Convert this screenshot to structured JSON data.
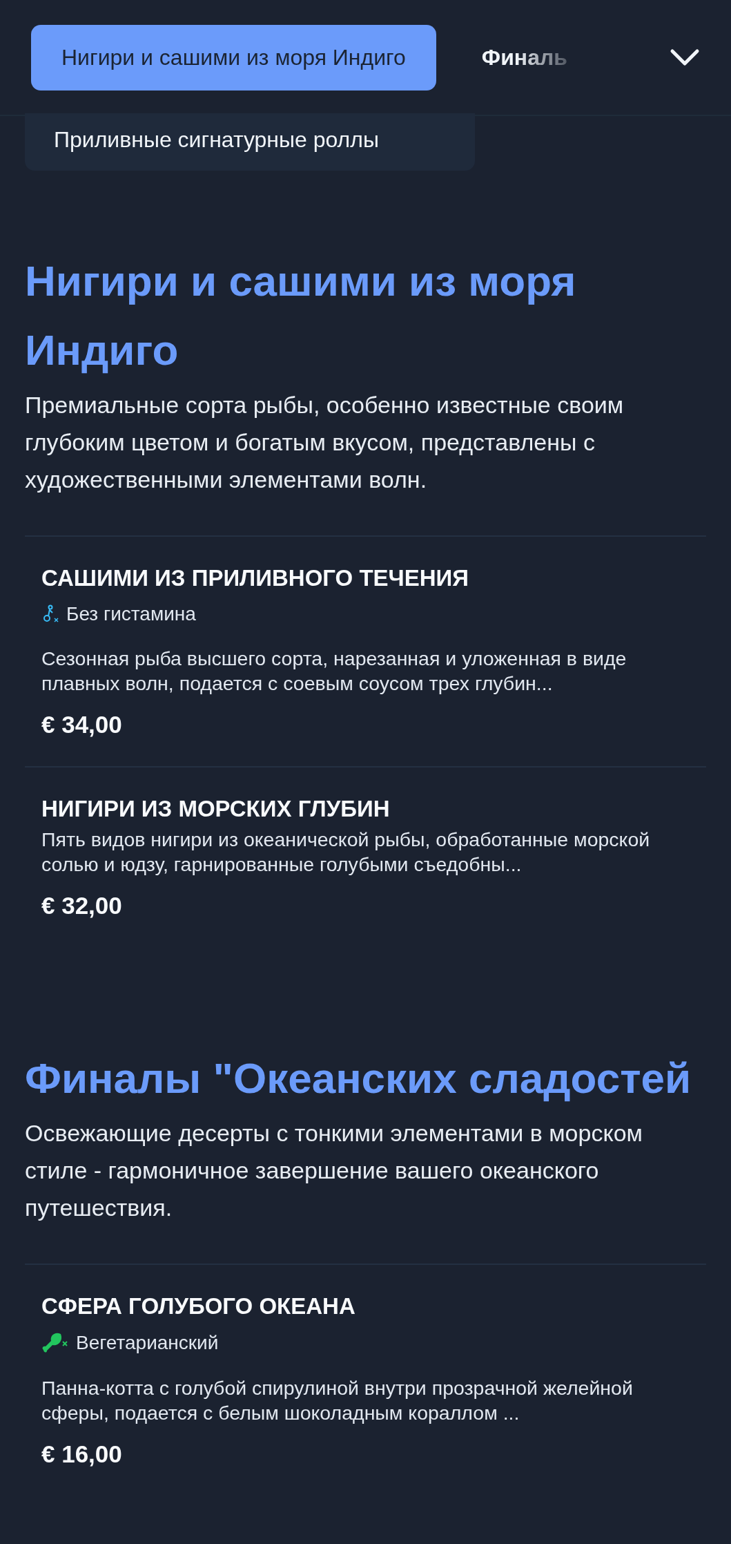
{
  "tabs": [
    {
      "label": "Нигири и сашими из моря Индиго",
      "selected": true
    },
    {
      "label": "Финаль",
      "selected": false
    }
  ],
  "menu": {
    "items": [
      "Приливные сигнатурные роллы"
    ]
  },
  "sections": [
    {
      "title": "Нигири и сашими из моря Индиго",
      "description": "Премиальные сорта рыбы, особенно известные своим глубоким цветом и богатым вкусом, представлены с художественными элементами волн.",
      "items": [
        {
          "name": "САШИМИ ИЗ ПРИЛИВНОГО ТЕЧЕНИЯ",
          "tag": {
            "kind": "histamine-free",
            "label": "Без гистамина",
            "color": "#38bdf8"
          },
          "description": "Сезонная рыба высшего сорта, нарезанная и уложенная в виде плавных волн, подается с соевым соусом трех глубин...",
          "price": "€ 34,00"
        },
        {
          "name": "НИГИРИ ИЗ МОРСКИХ ГЛУБИН",
          "description": "Пять видов нигири из океанической рыбы, обработанные морской солью и юдзу, гарнированные голубыми съедобны...",
          "price": "€ 32,00"
        }
      ]
    },
    {
      "title": "Финалы \"Океанских сладостей",
      "description": "Освежающие десерты с тонкими элементами в морском стиле - гармоничное завершение вашего океанского путешествия.",
      "items": [
        {
          "name": "СФЕРА ГОЛУБОГО ОКЕАНА",
          "tag": {
            "kind": "vegetarian",
            "label": "Вегетарианский",
            "color": "#22c55e"
          },
          "description": "Панна-котта с голубой спирулиной внутри прозрачной желейной сферы, подается с белым шоколадным кораллом ...",
          "price": "€ 16,00"
        }
      ]
    }
  ]
}
